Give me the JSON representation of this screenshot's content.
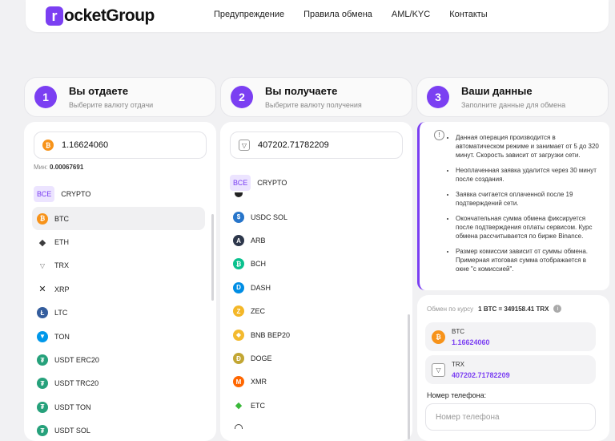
{
  "header": {
    "logo_letter": "r",
    "logo_text": "ocketGroup",
    "nav": [
      "Предупреждение",
      "Правила обмена",
      "AML/KYC",
      "Контакты"
    ]
  },
  "columns": [
    {
      "step": "1",
      "title": "Вы отдаете",
      "subtitle": "Выберите валюту отдачи"
    },
    {
      "step": "2",
      "title": "Вы получаете",
      "subtitle": "Выберите валюту получения"
    },
    {
      "step": "3",
      "title": "Ваши данные",
      "subtitle": "Заполните данные для обмена"
    }
  ],
  "give": {
    "amount": "1.16624060",
    "min_label": "Мин:",
    "min_value": "0.00067691",
    "tabs": [
      "ВСЕ",
      "CRYPTO"
    ],
    "coins": [
      {
        "name": "BTC",
        "icon": "btc-icon",
        "color": "#f7931a"
      },
      {
        "name": "ETH",
        "icon": "eth-icon",
        "color": "#3c3c3d"
      },
      {
        "name": "TRX",
        "icon": "trx-icon",
        "color": "#888888"
      },
      {
        "name": "XRP",
        "icon": "xrp-icon",
        "color": "#222222"
      },
      {
        "name": "LTC",
        "icon": "ltc-icon",
        "color": "#345d9d"
      },
      {
        "name": "TON",
        "icon": "ton-icon",
        "color": "#0098ea"
      },
      {
        "name": "USDT ERC20",
        "icon": "usdt-icon",
        "color": "#26a17b"
      },
      {
        "name": "USDT TRC20",
        "icon": "usdt-icon",
        "color": "#26a17b"
      },
      {
        "name": "USDT TON",
        "icon": "usdt-icon",
        "color": "#26a17b"
      },
      {
        "name": "USDT SOL",
        "icon": "usdt-icon",
        "color": "#26a17b"
      }
    ]
  },
  "get": {
    "amount": "407202.71782209",
    "tabs": [
      "ВСЕ",
      "CRYPTO"
    ],
    "coins": [
      {
        "name": "USDC SOL",
        "icon": "usdc-icon",
        "color": "#2775ca"
      },
      {
        "name": "ARB",
        "icon": "arb-icon",
        "color": "#2d374b"
      },
      {
        "name": "BCH",
        "icon": "bch-icon",
        "color": "#0ac18e"
      },
      {
        "name": "DASH",
        "icon": "dash-icon",
        "color": "#008de4"
      },
      {
        "name": "ZEC",
        "icon": "zec-icon",
        "color": "#f4b728"
      },
      {
        "name": "BNB BEP20",
        "icon": "bnb-icon",
        "color": "#f3ba2f"
      },
      {
        "name": "DOGE",
        "icon": "doge-icon",
        "color": "#c2a633"
      },
      {
        "name": "XMR",
        "icon": "xmr-icon",
        "color": "#ff6600"
      },
      {
        "name": "ETC",
        "icon": "etc-icon",
        "color": "#3ab83a"
      }
    ]
  },
  "info": [
    "Данная операция производится в автоматическом режиме и занимает от 5 до 320 минут. Скорость зависит от загрузки сети.",
    "Неоплаченная заявка удалится через 30 минут после создания.",
    "Заявка считается оплаченной после 19 подтверждений сети.",
    "Окончательная сумма обмена фиксируется после подтверждения оплаты сервисом. Курс обмена рассчитывается по бирже Binance.",
    "Размер комиссии зависит от суммы обмена. Примерная итоговая сумма отображается в окне \"с комиссией\"."
  ],
  "summary": {
    "rate_label": "Обмен по курсу",
    "rate_value": "1 BTC = 349158.41 TRX",
    "from_name": "BTC",
    "from_value": "1.16624060",
    "to_name": "TRX",
    "to_value": "407202.71782209",
    "phone_label": "Номер телефона:",
    "phone_placeholder": "Номер телефона"
  },
  "colors": {
    "accent": "#7b3ff2",
    "btc": "#f7931a"
  }
}
